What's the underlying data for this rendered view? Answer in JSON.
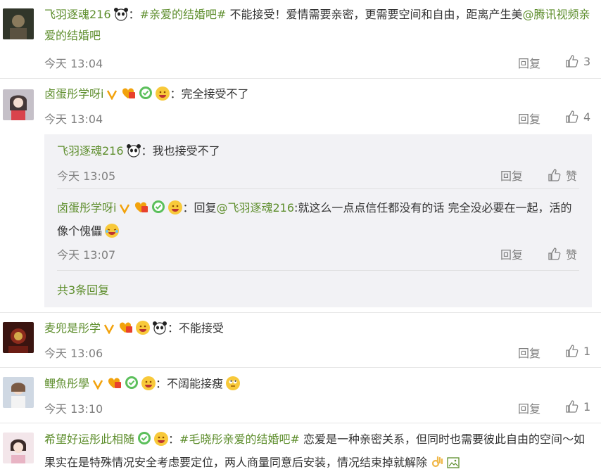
{
  "comments": [
    {
      "username": "飞羽逐魂216",
      "tag": "#亲爱的结婚吧#",
      "text": "不能接受！爱情需要亲密，更需要空间和自由，距离产生美",
      "mention": "@腾讯视频亲爱的结婚吧",
      "time": "今天 13:04",
      "reply_label": "回复",
      "likes": "3"
    },
    {
      "username": "卤蛋彤学呀i",
      "separator": "：",
      "text": "完全接受不了",
      "time": "今天 13:04",
      "reply_label": "回复",
      "likes": "4"
    },
    {
      "username": "麦兜是彤学",
      "separator": "：",
      "text": "不能接受",
      "time": "今天 13:06",
      "reply_label": "回复",
      "likes": "1"
    },
    {
      "username": "鲤魚彤學",
      "separator": "：",
      "text": "不阔能接瘦",
      "time": "今天 13:10",
      "reply_label": "回复",
      "likes": "1"
    },
    {
      "username": "希望好运彤此相随",
      "separator": "：",
      "tag": "#毛晓彤亲爱的结婚吧#",
      "text": " 恋爱是一种亲密关系，但同时也需要彼此自由的空间～如果实在是特殊情况安全考虑要定位，两人商量同意后安装，情况结束掉就解除"
    }
  ],
  "replies": [
    {
      "username": "飞羽逐魂216",
      "separator": "：",
      "text": "我也接受不了",
      "time": "今天 13:05",
      "reply_label": "回复",
      "like_label": "赞"
    },
    {
      "username": "卤蛋彤学呀i",
      "separator": "：",
      "reply_prefix": "回复",
      "mention": "@飞羽逐魂216",
      "text": ":就这么一点点信任都没有的话 完全没必要在一起，活的像个傀儡",
      "time": "今天 13:07",
      "reply_label": "回复",
      "like_label": "赞"
    }
  ],
  "more_replies": "共3条回复",
  "colors": {
    "link_green": "#5e8e2d",
    "meta_gray": "#808080",
    "reply_bg": "#f2f2f5",
    "vip_gold": "#f2a20c"
  }
}
